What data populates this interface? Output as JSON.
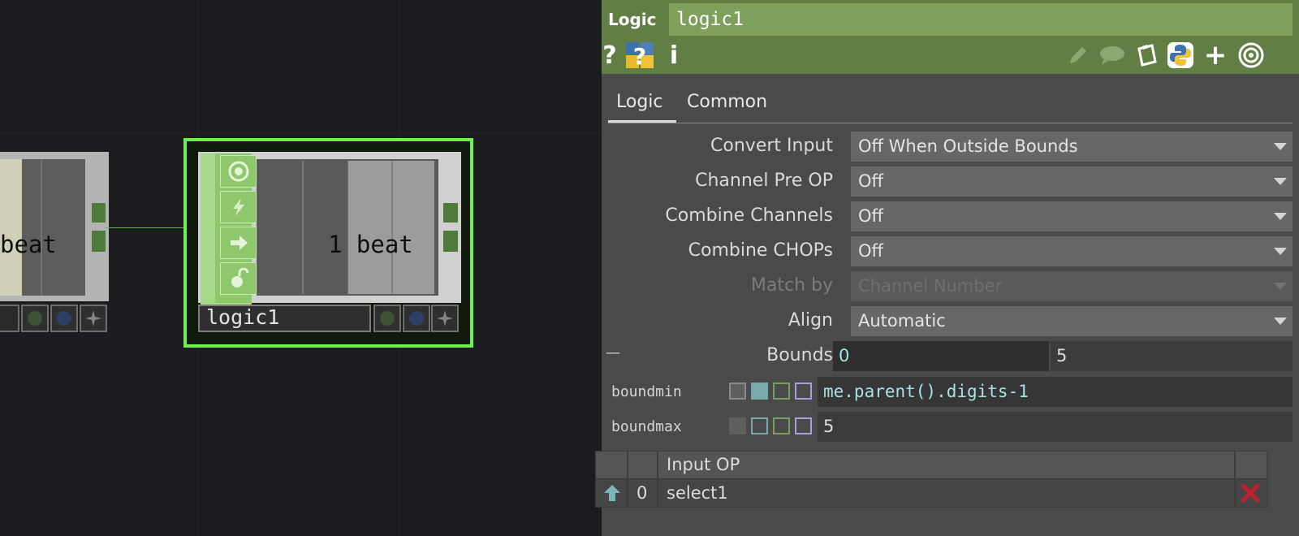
{
  "network": {
    "prev_node": {
      "text": "beat"
    },
    "logic_node": {
      "text": "1 beat",
      "name": "logic1"
    }
  },
  "panel": {
    "op_type": "Logic",
    "op_name": "logic1",
    "header_icons": [
      "help-icon",
      "python-help-icon",
      "info-icon",
      "edit-icon",
      "comment-icon",
      "clipboard-icon",
      "python-icon",
      "add-icon",
      "target-icon"
    ],
    "tabs": [
      {
        "label": "Logic",
        "active": true
      },
      {
        "label": "Common",
        "active": false
      }
    ],
    "params": {
      "convert_input": {
        "label": "Convert Input",
        "value": "Off When Outside Bounds"
      },
      "channel_pre_op": {
        "label": "Channel Pre OP",
        "value": "Off"
      },
      "combine_channels": {
        "label": "Combine Channels",
        "value": "Off"
      },
      "combine_chops": {
        "label": "Combine CHOPs",
        "value": "Off"
      },
      "match_by": {
        "label": "Match by",
        "value": "Channel Number",
        "enabled": false
      },
      "align": {
        "label": "Align",
        "value": "Automatic"
      },
      "bounds": {
        "label": "Bounds",
        "value1": "0",
        "value2": "5",
        "collapse_mark": "—"
      }
    },
    "expanded": {
      "boundmin": {
        "name": "boundmin",
        "expression": "me.parent().digits-1"
      },
      "boundmax": {
        "name": "boundmax",
        "value": "5"
      }
    },
    "input_table": {
      "header": "Input OP",
      "rows": [
        {
          "index": "0",
          "op": "select1"
        }
      ]
    }
  },
  "colors": {
    "header_green": "#617f45",
    "name_field_green": "#7fa05c",
    "selection_green": "#6ef04d",
    "node_green": "#a7d98a",
    "expression_text": "#a6e3e3",
    "delete_red": "#c0202f"
  }
}
